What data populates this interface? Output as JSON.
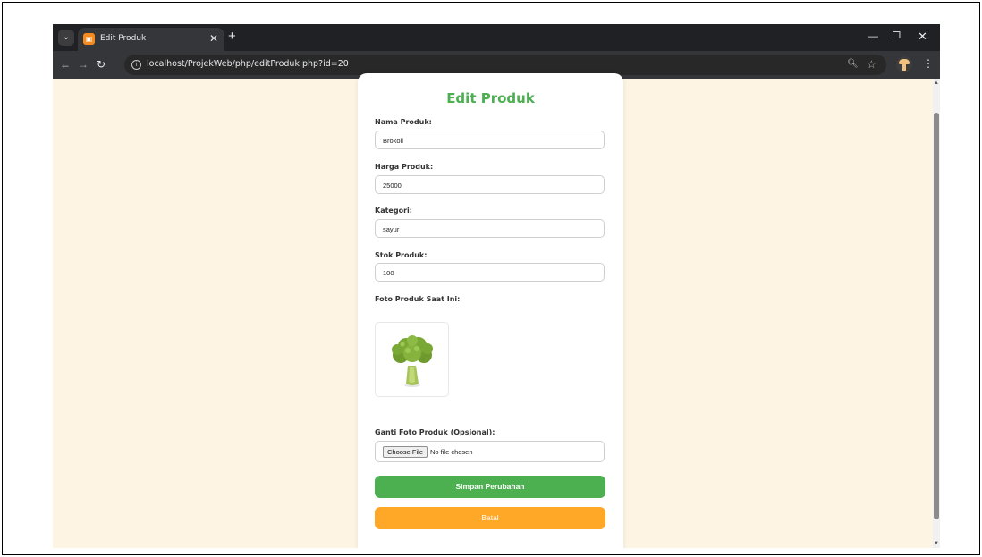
{
  "browser": {
    "tab_title": "Edit Produk",
    "tab_favicon": "favicon-icon",
    "url": "localhost/ProjekWeb/php/editProduk.php?id=20"
  },
  "form": {
    "title": "Edit Produk",
    "nama_label": "Nama Produk:",
    "nama_value": "Brokoli",
    "harga_label": "Harga Produk:",
    "harga_value": "25000",
    "kategori_label": "Kategori:",
    "kategori_value": "sayur",
    "stok_label": "Stok Produk:",
    "stok_value": "100",
    "foto_label": "Foto Produk Saat Ini:",
    "ganti_label": "Ganti Foto Produk (Opsional):",
    "choose_file_label": "Choose File",
    "file_status": "No file chosen",
    "save_label": "Simpan Perubahan",
    "cancel_label": "Batal"
  },
  "colors": {
    "primary": "#4caf50",
    "cancel": "#ffa726",
    "page_bg": "#fdf4e4"
  }
}
